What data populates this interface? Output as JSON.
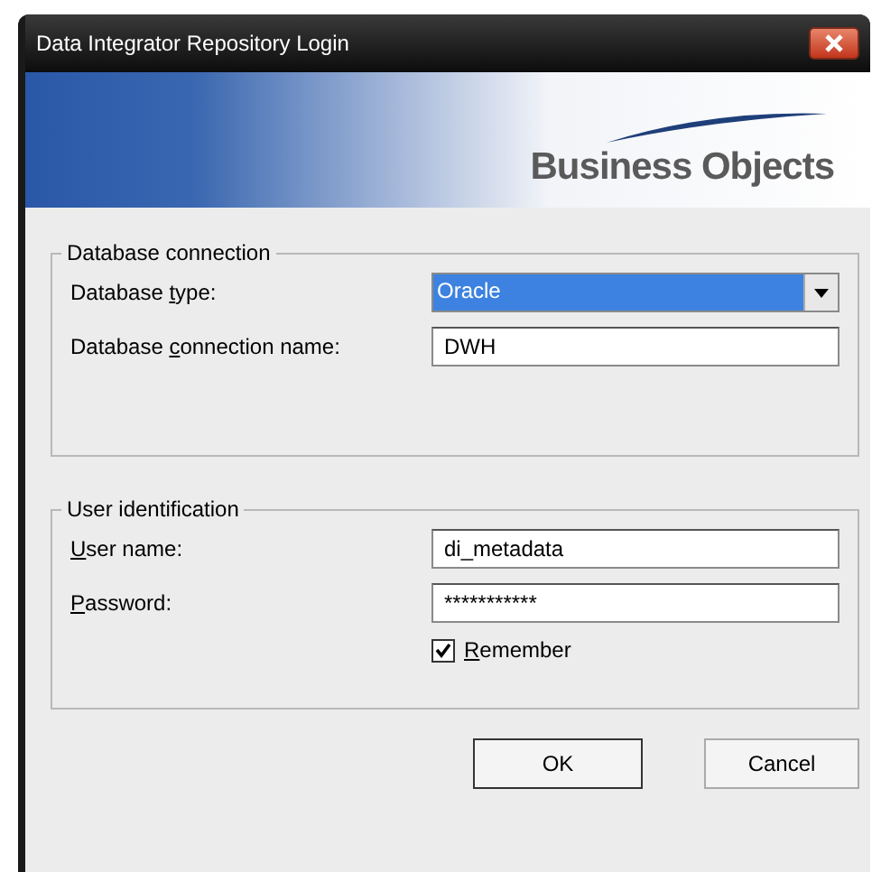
{
  "window": {
    "title": "Data Integrator Repository Login"
  },
  "banner": {
    "logo_text": "Business Objects"
  },
  "groups": [
    {
      "title": "Database connection",
      "fields": [
        {
          "kind": "dropdown",
          "label": {
            "before": "Database ",
            "key": "t",
            "after": "ype:"
          },
          "value": "Oracle",
          "selected": true
        },
        {
          "kind": "text",
          "label": {
            "before": "Database ",
            "key": "c",
            "after": "onnection name:"
          },
          "value": "DWH"
        }
      ]
    },
    {
      "title": "User identification",
      "fields": [
        {
          "kind": "text",
          "label": {
            "key": "U",
            "after": "ser name:"
          },
          "value": "di_metadata"
        },
        {
          "kind": "text",
          "label": {
            "key": "P",
            "after": "assword:"
          },
          "value": "***********"
        },
        {
          "kind": "checkbox",
          "label": {
            "key": "R",
            "after": "emember"
          },
          "checked": true
        }
      ]
    }
  ],
  "buttons": [
    {
      "label": "OK",
      "default": true
    },
    {
      "label": "Cancel",
      "default": false
    }
  ]
}
